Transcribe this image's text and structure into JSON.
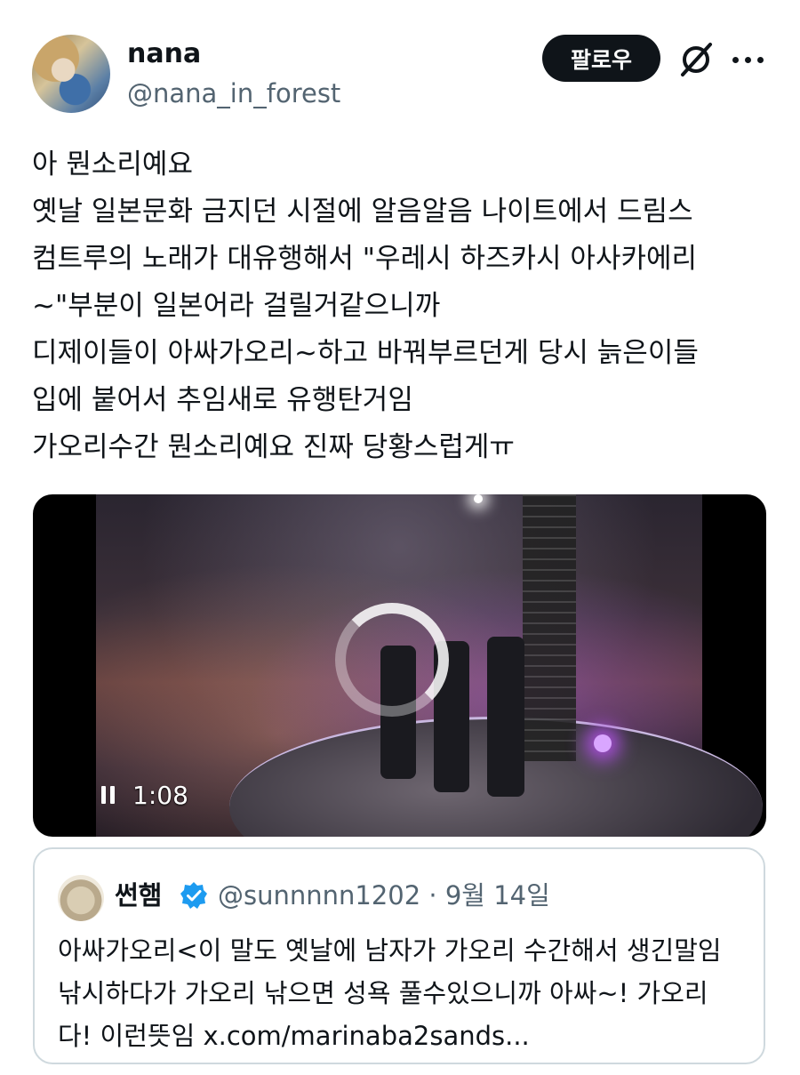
{
  "author": {
    "display_name": "nana",
    "handle": "@nana_in_forest"
  },
  "actions": {
    "follow_label": "팔로우"
  },
  "tweet": {
    "lines": [
      "아 뭔소리예요",
      "옛날 일본문화 금지던 시절에 알음알음 나이트에서 드림스",
      "컴트루의 노래가 대유행해서 \"우레시 하즈카시 아사카에리",
      "~\"부분이 일본어라 걸릴거같으니까",
      "디제이들이 아싸가오리~하고 바꿔부르던게 당시 늙은이들",
      "입에 붙어서 추임새로 유행탄거임",
      "가오리수간 뭔소리예요 진짜 당황스럽게ㅠ"
    ]
  },
  "video": {
    "time": "1:08"
  },
  "quote": {
    "display_name": "썬햄",
    "handle_date": "@sunnnnn1202 · 9월 14일",
    "lines": [
      "아싸가오리<이 말도 옛날에 남자가 가오리 수간해서 생긴말임",
      "낚시하다가 가오리 낚으면 성욕 풀수있으니까 아싸~! 가오리",
      "다! 이런뜻임 x.com/marinaba2sands..."
    ]
  },
  "colors": {
    "text": "#0f1419",
    "secondary": "#536471",
    "verified": "#1d9bf0",
    "border": "#cfd9de"
  }
}
